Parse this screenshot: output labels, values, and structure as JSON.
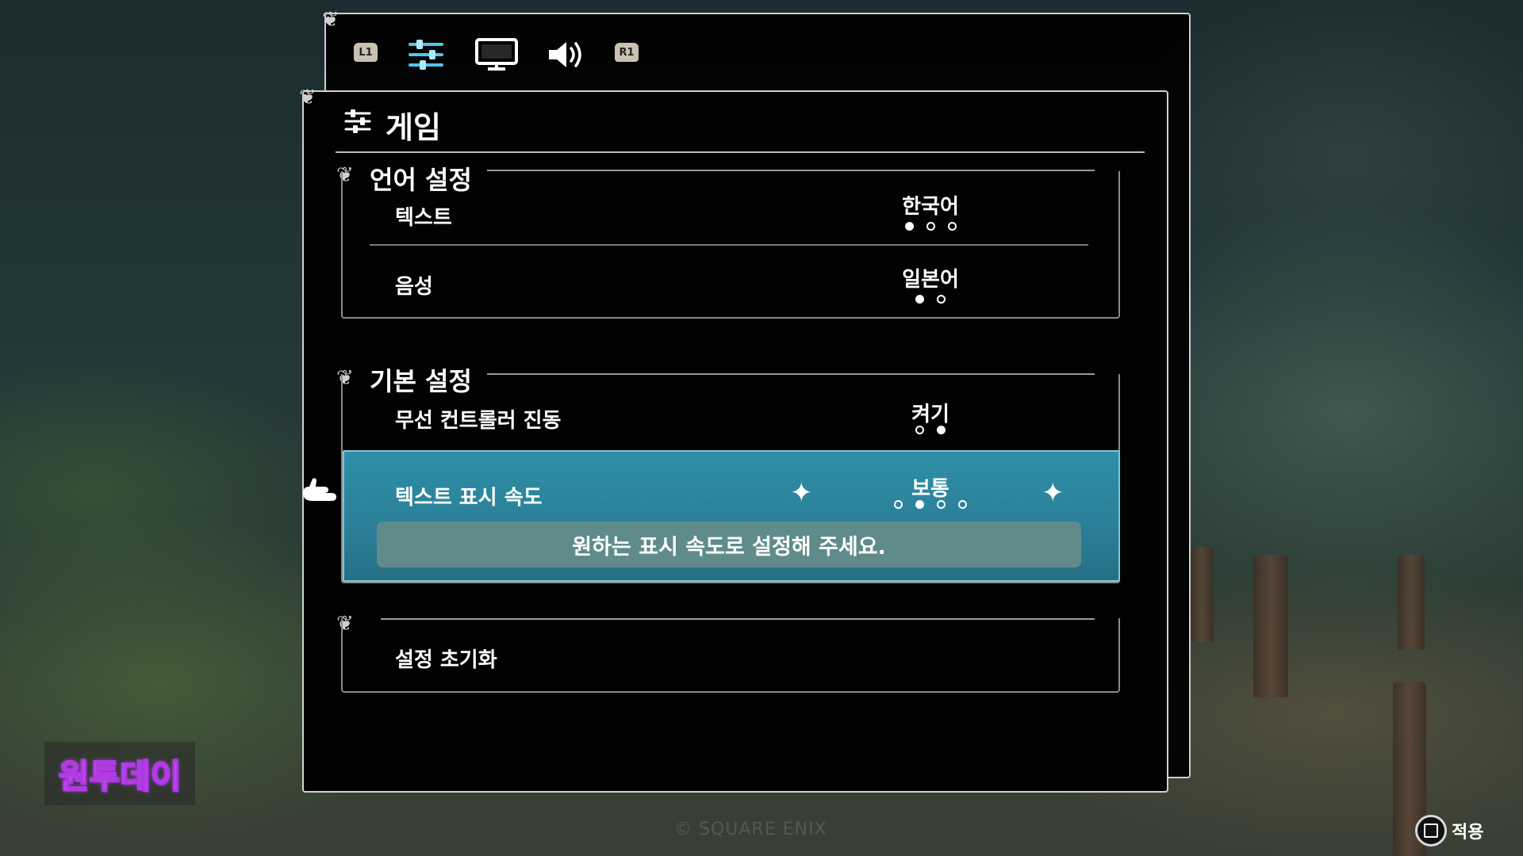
{
  "tabs": [
    {
      "label": "L1",
      "icon": "l1-shoulder-icon"
    },
    {
      "icon": "sliders-icon",
      "active": true
    },
    {
      "icon": "monitor-icon"
    },
    {
      "icon": "speaker-icon"
    },
    {
      "label": "R1",
      "icon": "r1-shoulder-icon"
    }
  ],
  "page": {
    "title": "게임",
    "icon": "sliders-icon"
  },
  "sections": {
    "language": {
      "heading": "언어 설정",
      "rows": [
        {
          "label": "텍스트",
          "value": "한국어",
          "option_count": 3,
          "selected_index": 0
        },
        {
          "label": "음성",
          "value": "일본어",
          "option_count": 2,
          "selected_index": 0
        }
      ]
    },
    "basic": {
      "heading": "기본 설정",
      "rows": [
        {
          "label": "무선 컨트롤러 진동",
          "value": "켜기",
          "option_count": 2,
          "selected_index": 1
        },
        {
          "label": "텍스트 표시 속도",
          "value": "보통",
          "option_count": 4,
          "selected_index": 1,
          "selected": true,
          "hint": "원하는 표시 속도로 설정해 주세요."
        }
      ]
    },
    "reset": {
      "label": "설정 초기화"
    }
  },
  "watermark": "원투데이",
  "footer": {
    "apply_label": "적용",
    "apply_icon": "square-button-icon",
    "copyright": "© SQUARE ENIX"
  },
  "colors": {
    "highlight": "#2a7f97",
    "hint_bg": "#5f8c8b",
    "watermark_stroke": "#b23be3"
  }
}
